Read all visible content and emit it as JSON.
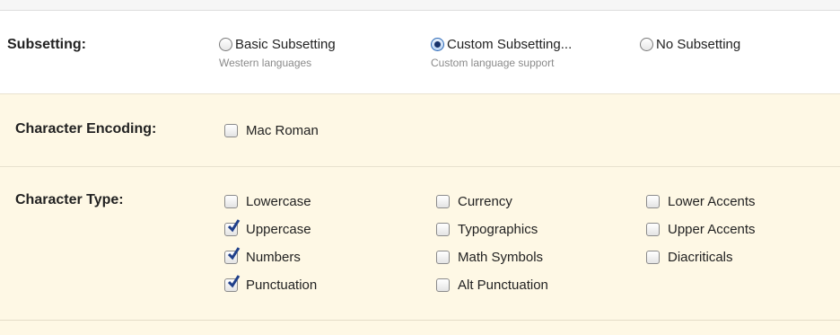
{
  "subsetting": {
    "label": "Subsetting:",
    "options": [
      {
        "label": "Basic Subsetting",
        "sublabel": "Western languages",
        "selected": false
      },
      {
        "label": "Custom Subsetting...",
        "sublabel": "Custom language support",
        "selected": true
      },
      {
        "label": "No Subsetting",
        "sublabel": "",
        "selected": false
      }
    ]
  },
  "encoding": {
    "label": "Character Encoding:",
    "options": [
      {
        "label": "Mac Roman",
        "checked": false
      }
    ]
  },
  "char_type": {
    "label": "Character Type:",
    "col1": [
      {
        "label": "Lowercase",
        "checked": false
      },
      {
        "label": "Uppercase",
        "checked": true
      },
      {
        "label": "Numbers",
        "checked": true
      },
      {
        "label": "Punctuation",
        "checked": true
      }
    ],
    "col2": [
      {
        "label": "Currency",
        "checked": false
      },
      {
        "label": "Typographics",
        "checked": false
      },
      {
        "label": "Math Symbols",
        "checked": false
      },
      {
        "label": "Alt Punctuation",
        "checked": false
      }
    ],
    "col3": [
      {
        "label": "Lower Accents",
        "checked": false
      },
      {
        "label": "Upper Accents",
        "checked": false
      },
      {
        "label": "Diacriticals",
        "checked": false
      }
    ]
  },
  "colors": {
    "panel_bg": "#fef8e5",
    "check_color": "#1f3f8a",
    "radio_selected": "#17326a"
  }
}
